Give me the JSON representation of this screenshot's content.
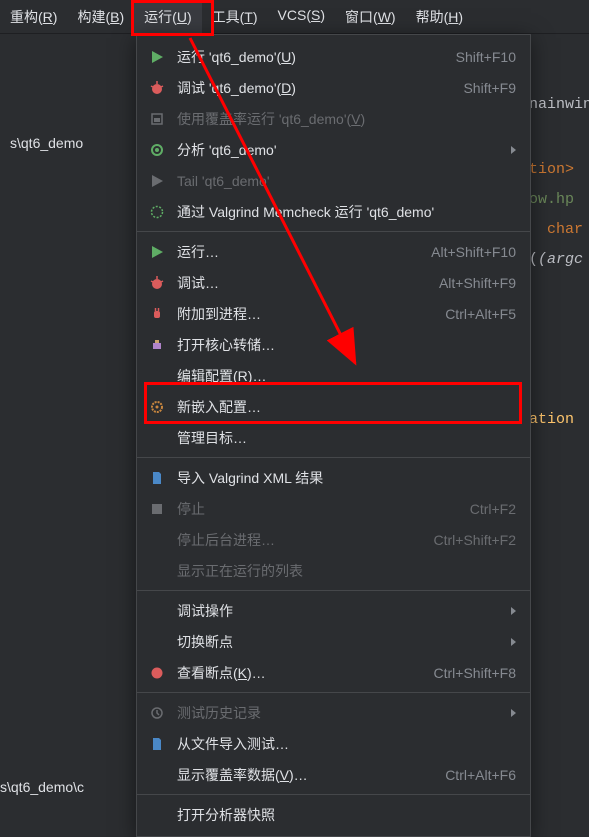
{
  "menubar": {
    "items": [
      {
        "label": "重构",
        "mnemonic": "R"
      },
      {
        "label": "构建",
        "mnemonic": "B"
      },
      {
        "label": "运行",
        "mnemonic": "U"
      },
      {
        "label": "工具",
        "mnemonic": "T"
      },
      {
        "label": "VCS",
        "mnemonic": "S"
      },
      {
        "label": "窗口",
        "mnemonic": "W"
      },
      {
        "label": "帮助",
        "mnemonic": "H"
      }
    ]
  },
  "sidebar": {
    "project_path": "s\\qt6_demo",
    "bottom_path": "s\\qt6_demo\\c"
  },
  "code": {
    "lines": [
      "nainwin",
      "tion>",
      "ow.hp",
      "  char",
      "(argc"
    ],
    "app_label": "ation"
  },
  "menu": [
    {
      "icon": "play-green",
      "label": "运行 'qt6_demo'(",
      "mnemonic": "U",
      "tail": ")",
      "shortcut": "Shift+F10"
    },
    {
      "icon": "bug-red",
      "label": "调试 'qt6_demo'(",
      "mnemonic": "D",
      "tail": ")",
      "shortcut": "Shift+F9"
    },
    {
      "icon": "coverage-gray",
      "label": "使用覆盖率运行 'qt6_demo'(",
      "mnemonic": "V",
      "tail": ")",
      "disabled": true
    },
    {
      "icon": "analyze-green",
      "label": "分析 'qt6_demo'",
      "submenu": true
    },
    {
      "icon": "play-gray",
      "label": "Tail 'qt6_demo'",
      "disabled": true
    },
    {
      "icon": "valgrind",
      "label": "通过 Valgrind Memcheck 运行 'qt6_demo'"
    },
    {
      "sep": true
    },
    {
      "icon": "play-green",
      "label": "运行…",
      "shortcut": "Alt+Shift+F10"
    },
    {
      "icon": "bug-red",
      "label": "调试…",
      "shortcut": "Alt+Shift+F9"
    },
    {
      "icon": "plug-red",
      "label": "附加到进程…",
      "shortcut": "Ctrl+Alt+F5"
    },
    {
      "icon": "core",
      "label": "打开核心转储…"
    },
    {
      "icon": "",
      "label": "编辑配置(",
      "mnemonic": "R",
      "tail": ")…"
    },
    {
      "icon": "gear-orange",
      "label": "新嵌入配置…"
    },
    {
      "icon": "",
      "label": "管理目标…"
    },
    {
      "sep": true
    },
    {
      "icon": "file-blue",
      "label": "导入 Valgrind XML 结果"
    },
    {
      "icon": "stop-gray",
      "label": "停止",
      "shortcut": "Ctrl+F2",
      "disabled": true
    },
    {
      "icon": "",
      "label": "停止后台进程…",
      "shortcut": "Ctrl+Shift+F2",
      "disabled": true
    },
    {
      "icon": "",
      "label": "显示正在运行的列表",
      "disabled": true
    },
    {
      "sep": true
    },
    {
      "icon": "",
      "label": "调试操作",
      "submenu": true
    },
    {
      "icon": "",
      "label": "切换断点",
      "submenu": true
    },
    {
      "icon": "breakpoint",
      "label": "查看断点(",
      "mnemonic": "K",
      "tail": ")…",
      "shortcut": "Ctrl+Shift+F8"
    },
    {
      "sep": true
    },
    {
      "icon": "history-gray",
      "label": "测试历史记录",
      "submenu": true,
      "disabled": true
    },
    {
      "icon": "file-blue",
      "label": "从文件导入测试…"
    },
    {
      "icon": "",
      "label": "显示覆盖率数据(",
      "mnemonic": "V",
      "tail": ")…",
      "shortcut": "Ctrl+Alt+F6"
    },
    {
      "sep": true
    },
    {
      "icon": "",
      "label": "打开分析器快照"
    }
  ]
}
